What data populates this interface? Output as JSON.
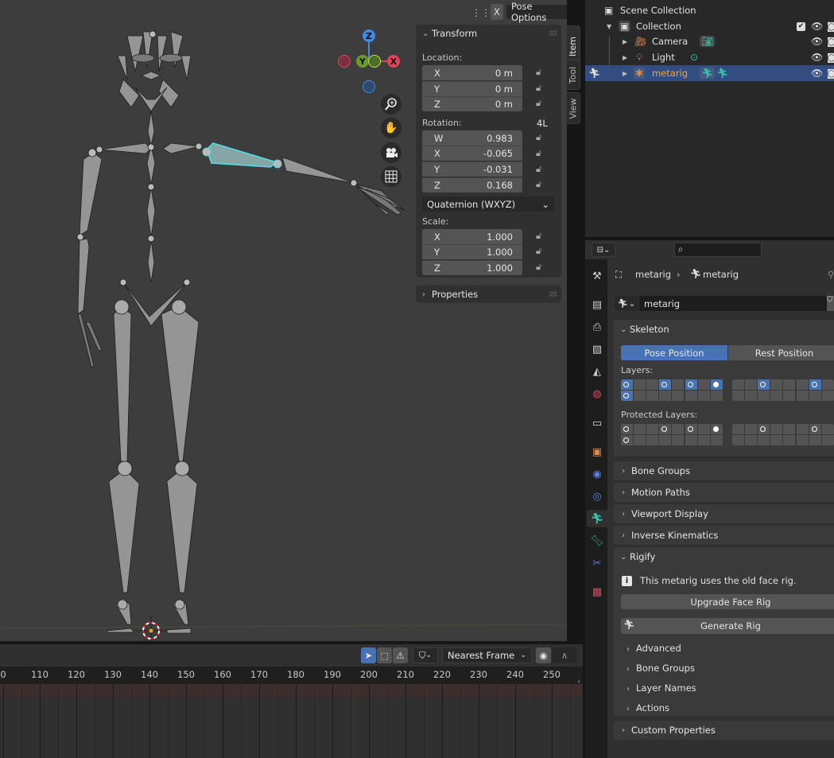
{
  "viewport": {
    "header": {
      "mirror_icon": "butterfly-mirror-icon",
      "x_mirror_label": "X",
      "pose_options_label": "Pose Options"
    },
    "gizmo": {
      "z": "Z",
      "y": "Y",
      "x": "X"
    },
    "nav_buttons": [
      "zoom-icon",
      "hand-pan-icon",
      "camera-icon",
      "grid-ortho-icon"
    ],
    "colors": {
      "x_axis": "#e0435a",
      "y_axis": "#8cc43a",
      "z_axis": "#3f8ae0",
      "selection": "#4fe0e8"
    }
  },
  "npanel": {
    "tabs": [
      "Item",
      "Tool",
      "View"
    ],
    "active_tab": "Item",
    "transform": {
      "title": "Transform",
      "location_label": "Location:",
      "location": [
        {
          "axis": "X",
          "value": "0 m"
        },
        {
          "axis": "Y",
          "value": "0 m"
        },
        {
          "axis": "Z",
          "value": "0 m"
        }
      ],
      "rotation_label": "Rotation:",
      "rotation_mode_badge": "4L",
      "rotation": [
        {
          "axis": "W",
          "value": "0.983"
        },
        {
          "axis": "X",
          "value": "-0.065"
        },
        {
          "axis": "Y",
          "value": "-0.031"
        },
        {
          "axis": "Z",
          "value": "0.168"
        }
      ],
      "rotation_mode": "Quaternion (WXYZ)",
      "scale_label": "Scale:",
      "scale": [
        {
          "axis": "X",
          "value": "1.000"
        },
        {
          "axis": "Y",
          "value": "1.000"
        },
        {
          "axis": "Z",
          "value": "1.000"
        }
      ]
    },
    "properties_title": "Properties"
  },
  "timeline": {
    "snap_mode": "Nearest Frame",
    "ticks": [
      "0",
      "110",
      "120",
      "130",
      "140",
      "150",
      "160",
      "170",
      "180",
      "190",
      "200",
      "210",
      "220",
      "230",
      "240",
      "250"
    ]
  },
  "outliner": {
    "scene_collection": "Scene Collection",
    "collection": "Collection",
    "items": [
      {
        "name": "Camera",
        "type": "camera"
      },
      {
        "name": "Light",
        "type": "light"
      },
      {
        "name": "metarig",
        "type": "armature",
        "selected": true
      }
    ]
  },
  "properties": {
    "breadcrumb": {
      "object": "metarig",
      "data": "metarig"
    },
    "datablock_name": "metarig",
    "skeleton": {
      "title": "Skeleton",
      "pose_position": "Pose Position",
      "rest_position": "Rest Position",
      "active_position": "Pose Position",
      "layers_label": "Layers:",
      "protected_layers_label": "Protected Layers:"
    },
    "collapsed_panels": [
      "Bone Groups",
      "Motion Paths",
      "Viewport Display",
      "Inverse Kinematics"
    ],
    "rigify": {
      "title": "Rigify",
      "info": "This metarig uses the old face rig.",
      "upgrade_button": "Upgrade Face Rig",
      "generate_button": "Generate Rig",
      "subpanels": [
        "Advanced",
        "Bone Groups",
        "Layer Names",
        "Actions"
      ]
    },
    "custom_properties": "Custom Properties",
    "tabs": [
      "tool-icon",
      "render-icon",
      "output-icon",
      "view-layer-icon",
      "scene-icon",
      "world-icon",
      "collection-icon",
      "object-icon",
      "modifier-physics-icon",
      "constraint-icon",
      "armature-data-icon",
      "bone-icon",
      "bone-constraint-icon",
      "texture-icon"
    ],
    "active_tab": "armature-data-icon"
  }
}
